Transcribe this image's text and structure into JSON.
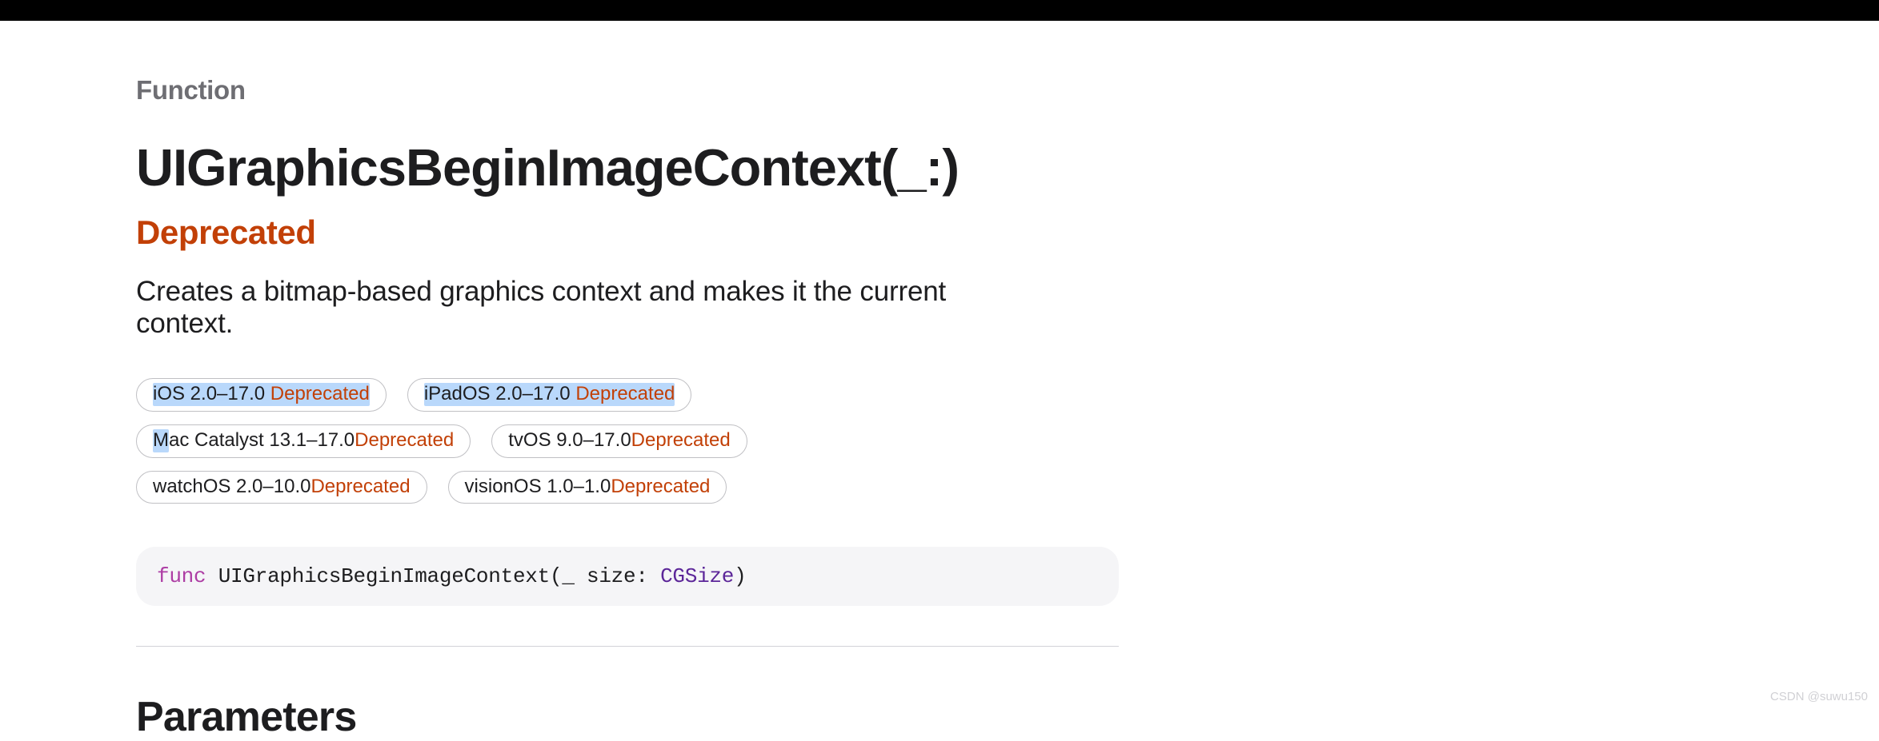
{
  "eyebrow": "Function",
  "title": "UIGraphicsBeginImageContext(_:)",
  "deprecated_label": "Deprecated",
  "summary": "Creates a bitmap-based graphics context and makes it the current context.",
  "availability": [
    {
      "platform": "iOS 2.0–17.0",
      "status": "Deprecated",
      "highlight": "full"
    },
    {
      "platform": "iPadOS 2.0–17.0",
      "status": "Deprecated",
      "highlight": "full"
    },
    {
      "platform": "Mac Catalyst 13.1–17.0",
      "status": "Deprecated",
      "highlight": "first-char"
    },
    {
      "platform": "tvOS 9.0–17.0",
      "status": "Deprecated",
      "highlight": "none"
    },
    {
      "platform": "watchOS 2.0–10.0",
      "status": "Deprecated",
      "highlight": "none"
    },
    {
      "platform": "visionOS 1.0–1.0",
      "status": "Deprecated",
      "highlight": "none"
    }
  ],
  "code": {
    "keyword": "func",
    "name": " UIGraphicsBeginImageContext(",
    "anon": "_",
    "param": " size",
    "colon": ": ",
    "type": "CGSize",
    "close": ")"
  },
  "section_heading": "Parameters",
  "watermark": "CSDN @suwu150"
}
